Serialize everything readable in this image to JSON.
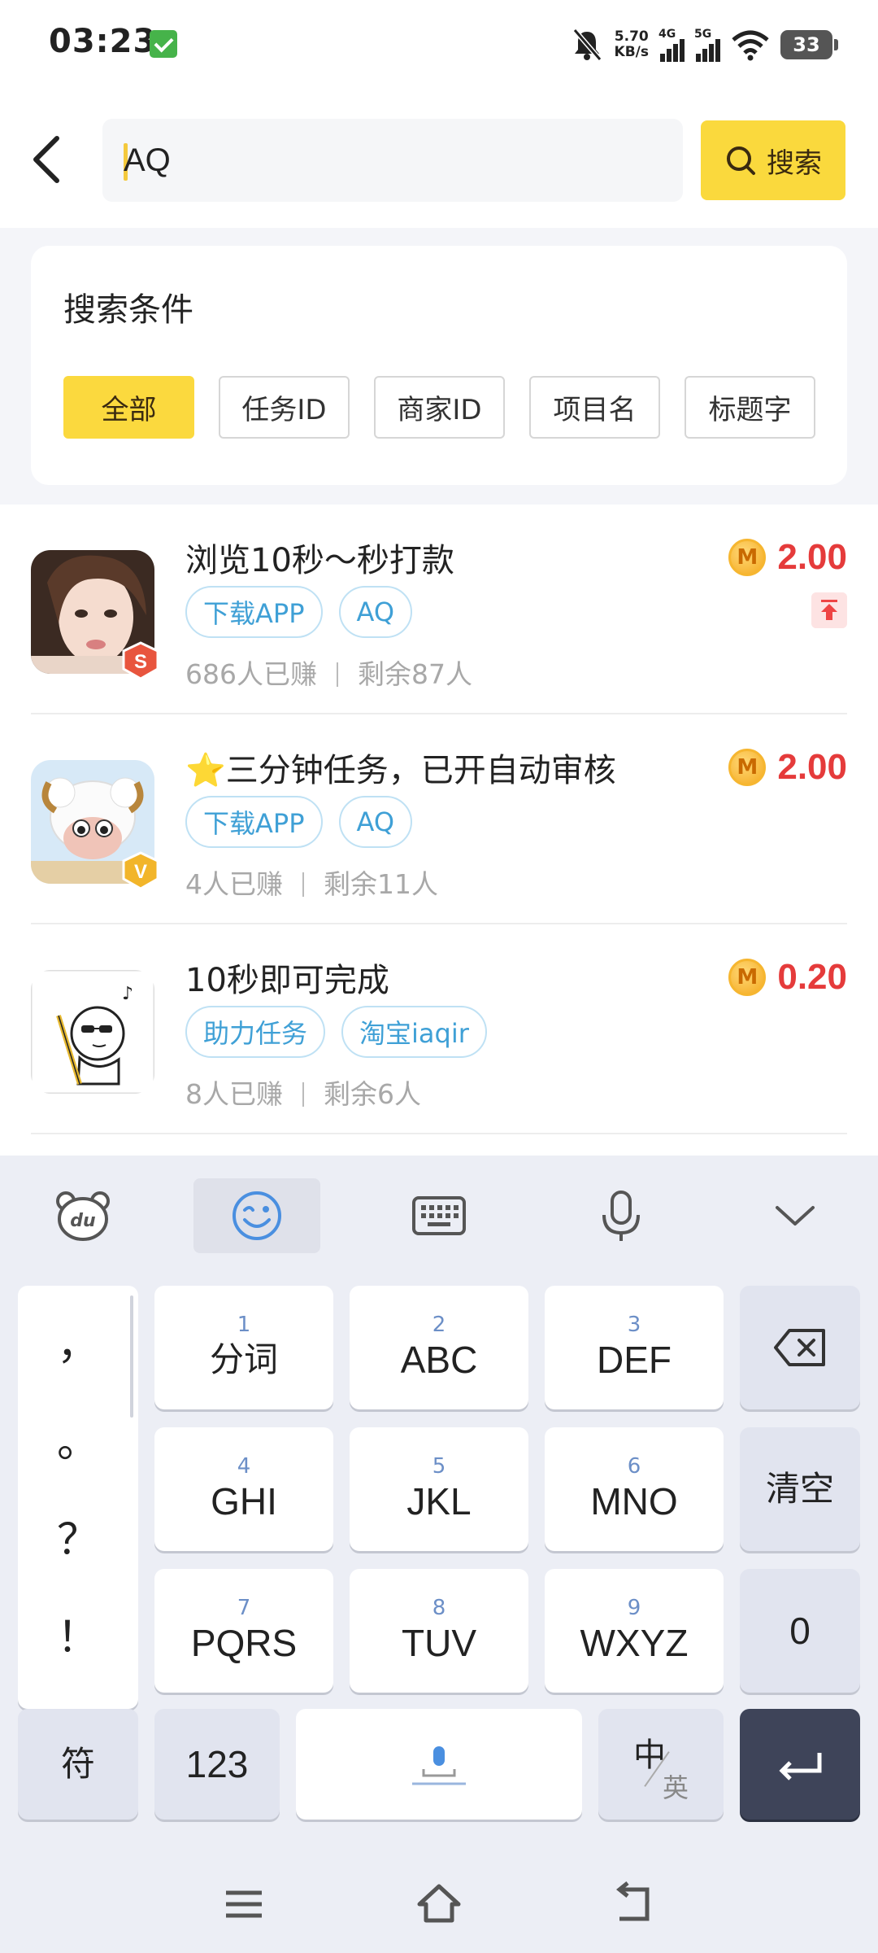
{
  "status_bar": {
    "time": "03:23",
    "net_speed_value": "5.70",
    "net_speed_unit": "KB/s",
    "sim1_label": "4G",
    "sim2_label": "5G",
    "battery": "33"
  },
  "header": {
    "search_value": "AQ",
    "search_button_label": "搜索"
  },
  "conditions": {
    "title": "搜索条件",
    "chips": [
      "全部",
      "任务ID",
      "商家ID",
      "项目名",
      "标题字"
    ],
    "active_chip": "全部",
    "accent_color": "#fbd93e"
  },
  "tasks": [
    {
      "title": "浏览10秒～秒打款",
      "tags": [
        "下载APP",
        "AQ"
      ],
      "earned": "686人已赚",
      "remaining": "剩余87人",
      "price": "2.00",
      "badge": "S",
      "pinned": true
    },
    {
      "title": "⭐三分钟任务，已开自动审核",
      "tags": [
        "下载APP",
        "AQ"
      ],
      "earned": "4人已赚",
      "remaining": "剩余11人",
      "price": "2.00",
      "badge": "V",
      "pinned": false
    },
    {
      "title": "10秒即可完成",
      "tags": [
        "助力任务",
        "淘宝iaqir"
      ],
      "earned": "8人已赚",
      "remaining": "剩余6人",
      "price": "0.20",
      "badge": "",
      "pinned": false
    }
  ],
  "coin_letter": "M",
  "keyboard": {
    "punctuation": [
      "，",
      "。",
      "？",
      "！"
    ],
    "keys": [
      {
        "num": "1",
        "label": "分词"
      },
      {
        "num": "2",
        "label": "ABC"
      },
      {
        "num": "3",
        "label": "DEF"
      },
      {
        "num": "4",
        "label": "GHI"
      },
      {
        "num": "5",
        "label": "JKL"
      },
      {
        "num": "6",
        "label": "MNO"
      },
      {
        "num": "7",
        "label": "PQRS"
      },
      {
        "num": "8",
        "label": "TUV"
      },
      {
        "num": "9",
        "label": "WXYZ"
      }
    ],
    "clear_label": "清空",
    "zero_label": "0",
    "symbol_label": "符",
    "numeric_label": "123",
    "lang_top": "中",
    "lang_bottom": "英",
    "toolbar_icons": [
      "du-bear-icon",
      "emoji-icon",
      "keyboard-icon",
      "microphone-icon",
      "chevron-down-icon"
    ]
  },
  "colors": {
    "price_red": "#e53b3b",
    "tag_blue": "#3fa0d6",
    "enter_key": "#3e4459"
  }
}
